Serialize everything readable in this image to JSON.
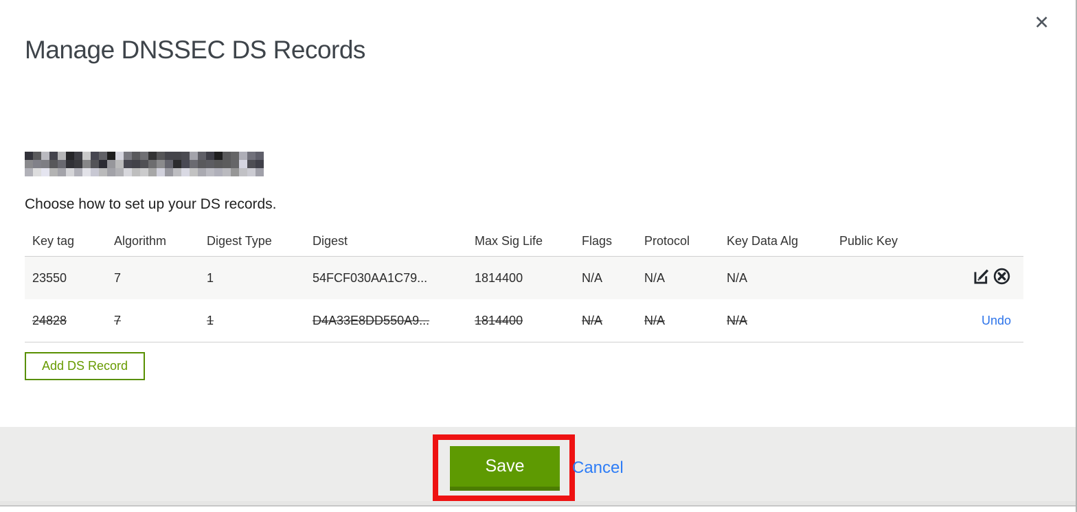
{
  "modal": {
    "title": "Manage DNSSEC DS Records",
    "close_label": "✕"
  },
  "content": {
    "domain_redacted": true,
    "instruction": "Choose how to set up your DS records."
  },
  "table": {
    "headers": [
      "Key tag",
      "Algorithm",
      "Digest Type",
      "Digest",
      "Max Sig Life",
      "Flags",
      "Protocol",
      "Key Data Alg",
      "Public Key"
    ],
    "rows": [
      {
        "key_tag": "23550",
        "algorithm": "7",
        "digest_type": "1",
        "digest": "54FCF030AA1C79...",
        "max_sig_life": "1814400",
        "flags": "N/A",
        "protocol": "N/A",
        "key_data_alg": "N/A",
        "public_key": "",
        "deleted": false
      },
      {
        "key_tag": "24828",
        "algorithm": "7",
        "digest_type": "1",
        "digest": "D4A33E8DD550A9...",
        "max_sig_life": "1814400",
        "flags": "N/A",
        "protocol": "N/A",
        "key_data_alg": "N/A",
        "public_key": "",
        "deleted": true
      }
    ],
    "undo_label": "Undo"
  },
  "buttons": {
    "add_record": "Add DS Record",
    "save": "Save",
    "cancel": "Cancel"
  },
  "colors": {
    "green": "#5e9a02",
    "green_dark": "#4c7d02",
    "add_button_green": "#588f00",
    "link_blue": "#2e7df6",
    "annotation_red": "#ee1212",
    "footer_bg": "#ececeb",
    "row_stripe": "#f7f7f6"
  }
}
